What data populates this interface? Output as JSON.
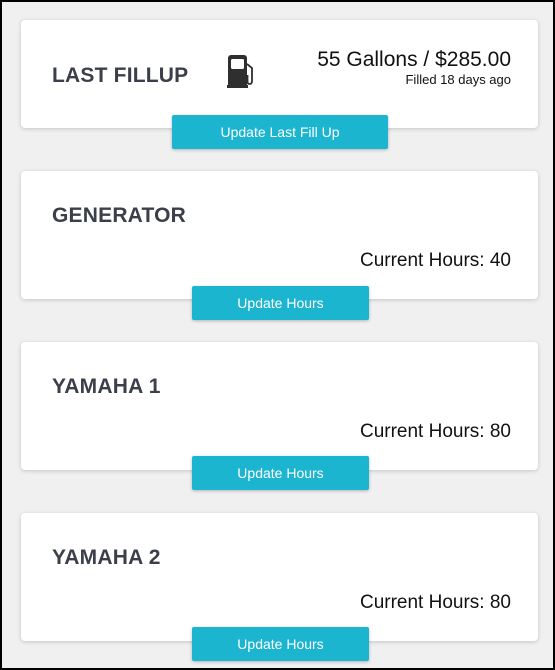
{
  "fillup": {
    "title": "LAST FILLUP",
    "summary": "55 Gallons / $285.00",
    "filled_ago": "Filled 18 days ago",
    "button_label": "Update Last Fill Up",
    "icon": "fuel-pump-icon"
  },
  "equipment": [
    {
      "name": "GENERATOR",
      "hours_text": "Current Hours: 40",
      "button_label": "Update Hours"
    },
    {
      "name": "YAMAHA 1",
      "hours_text": "Current Hours: 80",
      "button_label": "Update Hours"
    },
    {
      "name": "YAMAHA 2",
      "hours_text": "Current Hours: 80",
      "button_label": "Update Hours"
    }
  ],
  "colors": {
    "button": "#1cb5cf",
    "title": "#3b3f4a",
    "background": "#f0f0f0"
  }
}
